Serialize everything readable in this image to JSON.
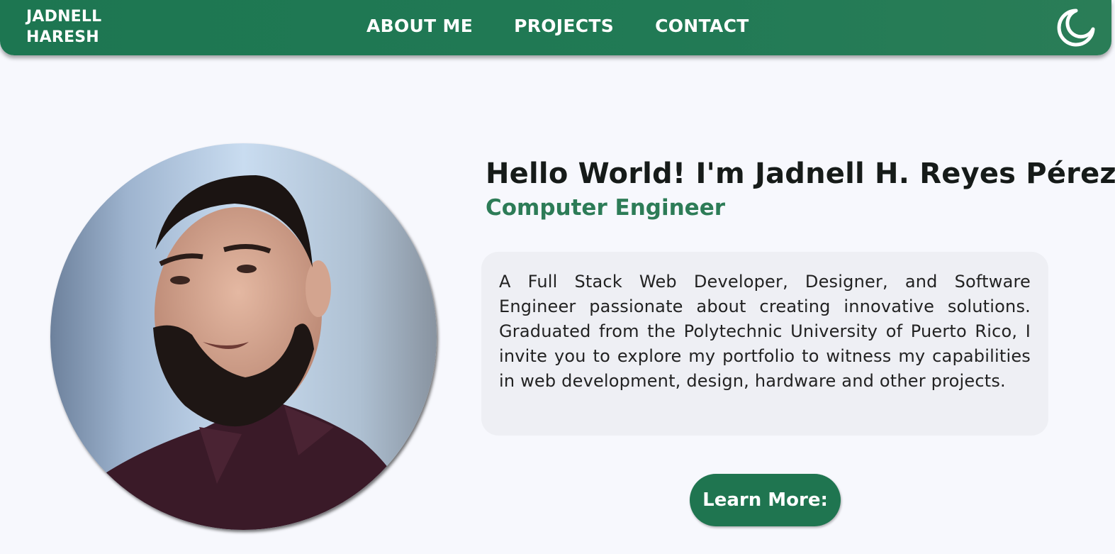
{
  "navbar": {
    "brand_line1": "JADNELL",
    "brand_line2": "HARESH",
    "links": [
      "ABOUT ME",
      "PROJECTS",
      "CONTACT"
    ],
    "theme_icon": "moon-icon",
    "accent_color": "#1d7651"
  },
  "hero": {
    "greeting": "Hello World! I'm Jadnell H. Reyes Pérez",
    "role": "Computer Engineer",
    "bio": "A Full Stack Web Developer, Designer, and Software Engineer passionate about creating innovative solutions. Graduated from the Polytechnic University of Puerto Rico, I invite you to explore my portfolio to witness my capabilities in web development, design, hardware and other projects.",
    "cta_label": "Learn More:",
    "role_color": "#2d7c57"
  }
}
